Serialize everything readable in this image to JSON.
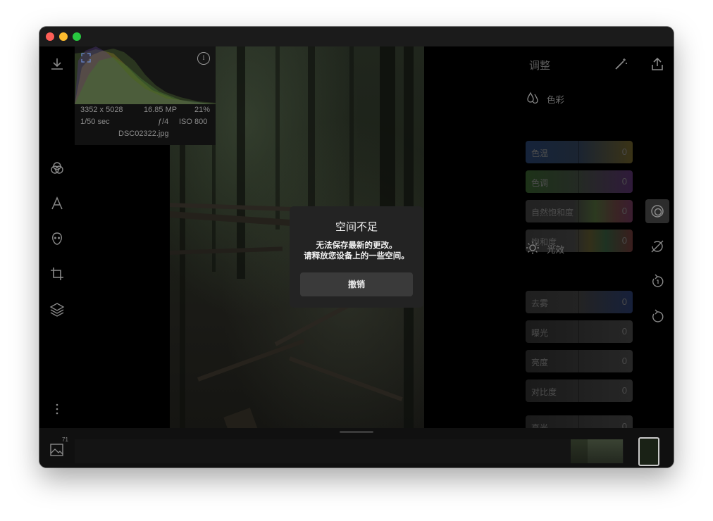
{
  "window": {
    "controls": [
      "close",
      "minimize",
      "maximize"
    ]
  },
  "histogram": {
    "dimensions": "3352 x 5028",
    "megapixels": "16.85 MP",
    "zoom": "21%",
    "shutter": "1/50 sec",
    "aperture": "ƒ/4",
    "iso": "ISO 800",
    "filename": "DSC02322.jpg",
    "info_glyph": "i"
  },
  "left_toolbar": {
    "icons": [
      "download-icon",
      "color-circles-icon",
      "text-icon",
      "face-icon",
      "crop-icon",
      "layers-icon",
      "more-icon"
    ]
  },
  "dialog": {
    "title": "空间不足",
    "message_line1": "无法保存最新的更改。",
    "message_line2": "请释放您设备上的一些空间。",
    "button": "撤销"
  },
  "adjust_panel": {
    "title": "调整",
    "color_section": "色彩",
    "color_sliders": [
      {
        "label": "色温",
        "value": "0"
      },
      {
        "label": "色调",
        "value": "0"
      },
      {
        "label": "自然饱和度",
        "value": "0"
      },
      {
        "label": "饱和度",
        "value": "0"
      }
    ],
    "light_section": "光效",
    "light_sliders": [
      {
        "label": "去雾",
        "value": "0"
      },
      {
        "label": "曝光",
        "value": "0"
      },
      {
        "label": "亮度",
        "value": "0"
      },
      {
        "label": "对比度",
        "value": "0"
      },
      {
        "label": "高光",
        "value": "0"
      }
    ]
  },
  "right_toolbar": {
    "icons": [
      "share-icon",
      "adjust-icon",
      "auto-off-icon",
      "undo-icon",
      "redo-icon",
      "compare-icon"
    ]
  },
  "filmstrip": {
    "photo_count": "71"
  },
  "colors": {
    "background": "#000000",
    "dialog": "#232323",
    "button": "#3a3a3a"
  }
}
